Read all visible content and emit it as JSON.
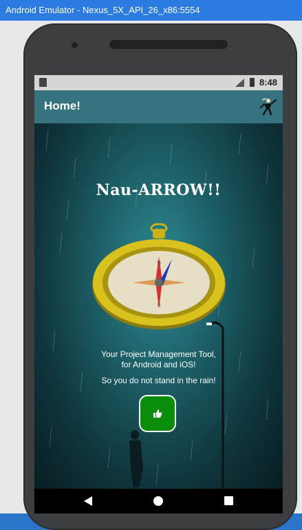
{
  "window": {
    "title": "Android Emulator - Nexus_5X_API_26_x86:5554"
  },
  "status_bar": {
    "time": "8:48"
  },
  "app_bar": {
    "title": "Home!"
  },
  "content": {
    "brand": "Nau-ARROW!!",
    "tagline_line1": "Your Project Management Tool,",
    "tagline_line2": "for Android and iOS!",
    "subline": "So you do not stand in the rain!"
  },
  "icons": {
    "like_button": "thumbs-up-icon",
    "app_bar_icon": "runner-figure-icon",
    "compass": "compass-image",
    "nav_back": "back-triangle-icon",
    "nav_home": "home-circle-icon",
    "nav_recent": "recents-square-icon"
  },
  "colors": {
    "app_bar": "#37727f",
    "like_button": "#0a8d0a",
    "titlebar": "#2b7be0"
  }
}
